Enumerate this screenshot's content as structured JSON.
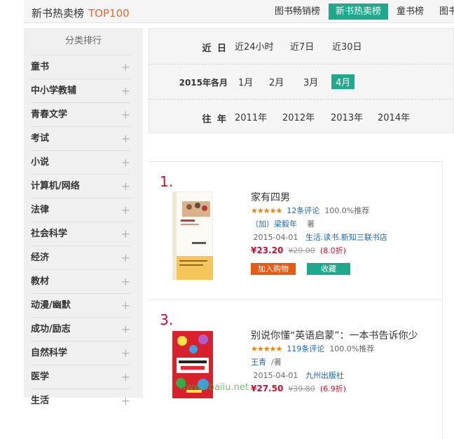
{
  "header": {
    "title": "新书热卖榜",
    "title_accent": "TOP100",
    "tabs": [
      "图书畅销榜",
      "新书热卖榜",
      "童书榜",
      "图书尾品"
    ],
    "active_tab": 1
  },
  "sidebar": {
    "heading": "分类排行",
    "items": [
      "童书",
      "中小学教辅",
      "青春文学",
      "考试",
      "小说",
      "计算机/网络",
      "法律",
      "社会科学",
      "经济",
      "教材",
      "动漫/幽默",
      "成功/励志",
      "自然科学",
      "医学",
      "生活"
    ]
  },
  "filters": {
    "recent": {
      "label": "近 日",
      "options": [
        "近24小时",
        "近7日",
        "近30日"
      ]
    },
    "month": {
      "label": "2015年各月",
      "options": [
        "1月",
        "2月",
        "3月",
        "4月"
      ],
      "active": 3
    },
    "past": {
      "label": "往 年",
      "options": [
        "2011年",
        "2012年",
        "2013年",
        "2014年"
      ]
    }
  },
  "products": [
    {
      "rank": "1.",
      "name": "家有四男",
      "stars": "★★★★★",
      "reviews": "12条评论",
      "recommend": "100.0%推荐",
      "author": "（加）梁毅年",
      "author_role": "著",
      "date": "2015-04-01",
      "publisher": "生活.读书.新知三联书店",
      "price": "¥23.20",
      "old_price": "¥29.00",
      "discount": "(8.0折)",
      "cart_label": "加入购物车",
      "fav_label": "收藏"
    },
    {
      "rank": "3.",
      "name": "别说你懂“英语启蒙”：一本书告诉你少",
      "stars": "★★★★★",
      "reviews": "119条评论",
      "recommend": "100.0%推荐",
      "author": "王青",
      "author_role": "/著",
      "date": "2015-04-01",
      "publisher": "九州出版社",
      "price": "¥27.50",
      "old_price": "¥39.80",
      "discount": "(6.9折)"
    }
  ],
  "watermark": "www.ebaiiu.net"
}
